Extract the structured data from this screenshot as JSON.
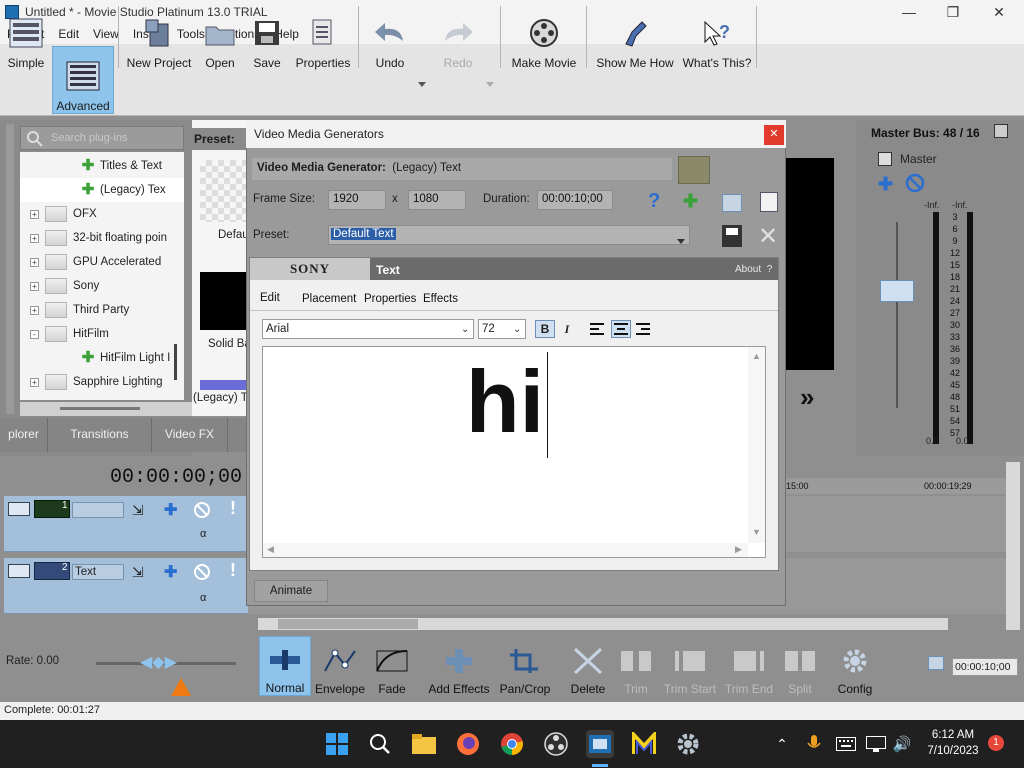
{
  "window": {
    "title": "Untitled * - Movie Studio Platinum 13.0 TRIAL"
  },
  "menu": [
    "Project",
    "Edit",
    "View",
    "Insert",
    "Tools",
    "Options",
    "Help"
  ],
  "toolbar": {
    "simple": "Simple",
    "advanced": "Advanced",
    "new_project": "New Project",
    "open": "Open",
    "save": "Save",
    "properties": "Properties",
    "undo": "Undo",
    "redo": "Redo",
    "make_movie": "Make Movie",
    "show_me_how": "Show Me How",
    "whats_this": "What's This?"
  },
  "plugins": {
    "search_placeholder": "Search plug-ins",
    "tree": [
      {
        "label": "Titles & Text",
        "type": "fx"
      },
      {
        "label": "(Legacy) Tex",
        "type": "fx",
        "selected": true
      },
      {
        "label": "OFX",
        "type": "folder",
        "expander": "+"
      },
      {
        "label": "32-bit floating poin",
        "type": "folder",
        "expander": "+"
      },
      {
        "label": "GPU Accelerated",
        "type": "folder",
        "expander": "+"
      },
      {
        "label": "Sony",
        "type": "folder",
        "expander": "+"
      },
      {
        "label": "Third Party",
        "type": "folder",
        "expander": "+"
      },
      {
        "label": "HitFilm",
        "type": "folder",
        "expander": "-"
      },
      {
        "label": "HitFilm Light I",
        "type": "fx"
      },
      {
        "label": "Sapphire Lighting",
        "type": "folder",
        "expander": "+"
      }
    ],
    "tabs": [
      "plorer",
      "Transitions",
      "Video FX"
    ]
  },
  "preset_panel": {
    "label": "Preset:",
    "thumb1": "Defau",
    "thumb2": "Solid Ba",
    "thumb3": "(Legacy) Te"
  },
  "dialog": {
    "title": "Video Media Generators",
    "generator_label": "Video Media Generator:",
    "generator_value": "(Legacy) Text",
    "frame_size_label": "Frame Size:",
    "width": "1920",
    "x_sep": "x",
    "height": "1080",
    "duration_label": "Duration:",
    "duration": "00:00:10;00",
    "preset_label": "Preset:",
    "preset_value": "Default Text",
    "plugin": {
      "brand": "SONY",
      "name": "Text",
      "about": "About",
      "about_q": "?",
      "tabs": [
        "Edit",
        "Placement",
        "Properties",
        "Effects"
      ],
      "font": "Arial",
      "size": "72",
      "bold": "B",
      "italic": "I",
      "text": "hi"
    },
    "animate": "Animate"
  },
  "master_bus": {
    "title": "Master Bus: 48 / 16",
    "label": "Master",
    "inf_left": "-Inf.",
    "inf_right": "-Inf.",
    "scale": [
      "3",
      "6",
      "9",
      "12",
      "15",
      "18",
      "21",
      "24",
      "27",
      "30",
      "33",
      "36",
      "39",
      "42",
      "45",
      "48",
      "51",
      "54",
      "57"
    ],
    "val_left": "0.0",
    "val_right": "0.0"
  },
  "timeline": {
    "timecode": "00:00:00;00",
    "ruler": [
      "15:00",
      "00:00:19;29"
    ],
    "tracks": [
      {
        "number": "1",
        "name": ""
      },
      {
        "number": "2",
        "name": "Text"
      }
    ],
    "rate": "Rate: 0.00",
    "end_time": "00:00:10;00"
  },
  "edit_tools": {
    "normal": "Normal",
    "envelope": "Envelope",
    "fade": "Fade",
    "add_effects": "Add Effects",
    "pan_crop": "Pan/Crop",
    "delete": "Delete",
    "trim": "Trim",
    "trim_start": "Trim Start",
    "trim_end": "Trim End",
    "split": "Split",
    "config": "Config"
  },
  "status": {
    "complete": "Complete: 00:01:27"
  },
  "taskbar": {
    "time": "6:12 AM",
    "date": "7/10/2023",
    "notification_count": "1"
  },
  "colors": {
    "accent_selected": "#8ec4ec",
    "close_red": "#e23b2e",
    "selection_blue": "#2d5fa8"
  }
}
